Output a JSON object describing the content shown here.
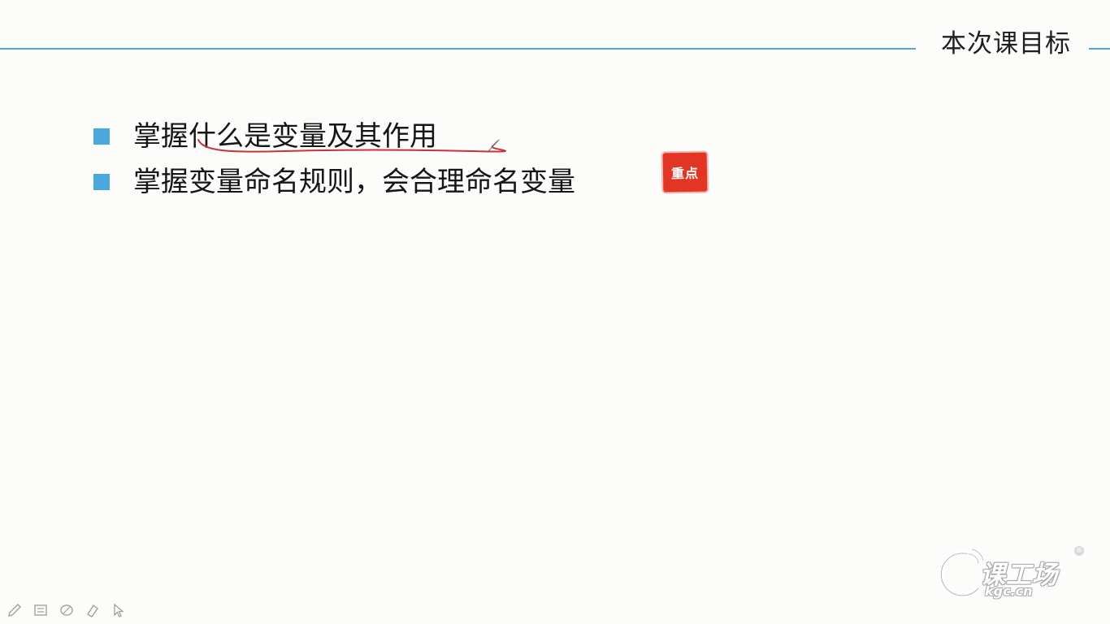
{
  "slide": {
    "title": "本次课目标",
    "bullets": [
      {
        "text": "掌握什么是变量及其作用"
      },
      {
        "text": "掌握变量命名规则，会合理命名变量"
      }
    ],
    "stamp": {
      "text": "重点"
    }
  },
  "logo": {
    "main": "课工场",
    "sub": "kgc.cn",
    "registered": "®"
  },
  "toolbar": {
    "tools": [
      "pen-icon",
      "slides-icon",
      "eraser-icon",
      "highlighter-icon",
      "pointer-icon"
    ]
  },
  "colors": {
    "accent_blue": "#4aa8de",
    "stamp_red": "#e33524",
    "annotation_red": "#c8323a"
  }
}
